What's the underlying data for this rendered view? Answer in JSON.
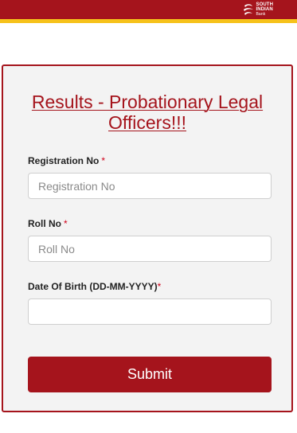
{
  "header": {
    "logo_line1": "SOUTH",
    "logo_line2": "INDIAN",
    "logo_line3": "Bank",
    "brand_color": "#a5141c",
    "stripe_color": "#f6c21b"
  },
  "form": {
    "title": "Results - Probationary Legal Officers!!!",
    "registration": {
      "label": "Registration No",
      "required_mark": "*",
      "placeholder": "Registration No",
      "value": ""
    },
    "roll": {
      "label": "Roll No",
      "required_mark": "*",
      "placeholder": "Roll No",
      "value": ""
    },
    "dob": {
      "label": "Date Of Birth (DD-MM-YYYY)",
      "required_mark": "*",
      "placeholder": "",
      "value": ""
    },
    "submit_label": "Submit"
  }
}
